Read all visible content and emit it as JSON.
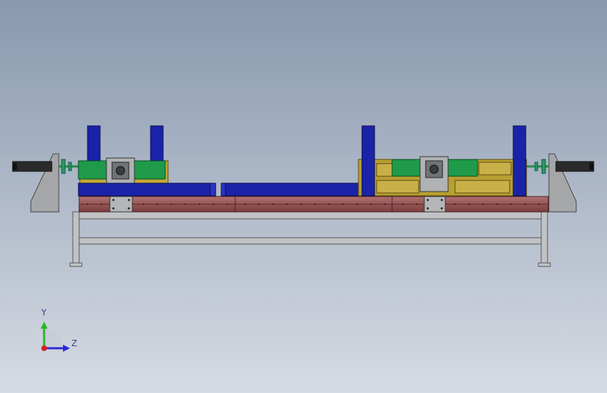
{
  "viewport": {
    "background_top": "#8898ae",
    "background_bottom": "#d4d9e2"
  },
  "triad": {
    "y_label": "Y",
    "z_label": "Z",
    "y_axis_color": "#2ab52a",
    "z_axis_color": "#2a2ad8",
    "x_axis_color": "#d82020"
  },
  "model_colors": {
    "blue_member": "#1a23a8",
    "green_actuator": "#1f9a4a",
    "yellow_frame": "#b8a030",
    "maroon_rail": "#8a4848",
    "gray_plate": "#a8aaac",
    "table_frame": "#b0b2b6"
  }
}
